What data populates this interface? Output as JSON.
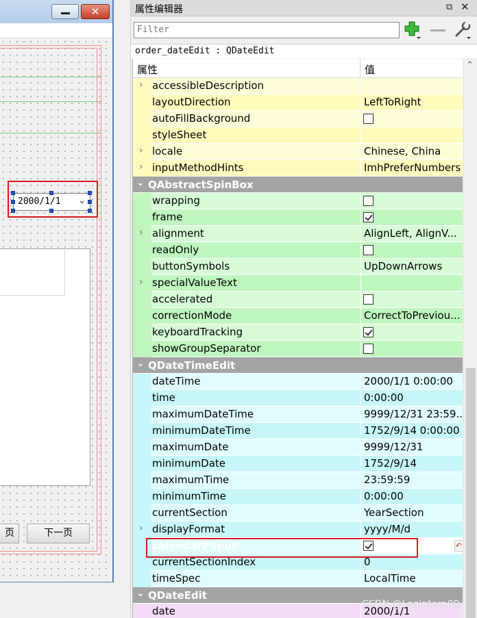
{
  "form": {
    "date_value": "2000/1/1",
    "prev_button": "页",
    "next_button": "下一页"
  },
  "panel": {
    "title": "属性编辑器",
    "filter_placeholder": "Filter",
    "object_label": "order_dateEdit : QDateEdit",
    "col_property": "属性",
    "col_value": "值"
  },
  "icons": {
    "float": "restore-icon",
    "close": "close-icon",
    "add": "plus-icon",
    "remove": "minus-icon",
    "config": "wrench-icon"
  },
  "colors": {
    "qwidget_row": "#fffdd8",
    "qwidget_row_alt": "#fffbbd",
    "spinbox_row": "#d6fbd6",
    "spinbox_row_alt": "#bff5bf",
    "datetime_row": "#e0fcfd",
    "datetime_row_alt": "#c7f6f9",
    "dateedit_row": "#f2dcf6",
    "selection": "#0a74d3",
    "category": "#a4a4a4"
  },
  "rows": [
    {
      "type": "prop",
      "name": "accessibleDescription",
      "value": "",
      "expandable": true,
      "group": "qwidget",
      "alt": false
    },
    {
      "type": "prop",
      "name": "layoutDirection",
      "value": "LeftToRight",
      "group": "qwidget",
      "alt": true
    },
    {
      "type": "prop",
      "name": "autoFillBackground",
      "checkbox": false,
      "group": "qwidget",
      "alt": false
    },
    {
      "type": "prop",
      "name": "styleSheet",
      "value": "",
      "group": "qwidget",
      "alt": true
    },
    {
      "type": "prop",
      "name": "locale",
      "value": "Chinese, China",
      "expandable": true,
      "group": "qwidget",
      "alt": false
    },
    {
      "type": "prop",
      "name": "inputMethodHints",
      "value": "ImhPreferNumbers",
      "expandable": true,
      "group": "qwidget",
      "alt": true
    },
    {
      "type": "cat",
      "name": "QAbstractSpinBox"
    },
    {
      "type": "prop",
      "name": "wrapping",
      "checkbox": false,
      "group": "spinbox",
      "alt": false
    },
    {
      "type": "prop",
      "name": "frame",
      "checkbox": true,
      "group": "spinbox",
      "alt": true
    },
    {
      "type": "prop",
      "name": "alignment",
      "value": "AlignLeft, AlignV...",
      "expandable": true,
      "group": "spinbox",
      "alt": false
    },
    {
      "type": "prop",
      "name": "readOnly",
      "checkbox": false,
      "group": "spinbox",
      "alt": true
    },
    {
      "type": "prop",
      "name": "buttonSymbols",
      "value": "UpDownArrows",
      "group": "spinbox",
      "alt": false
    },
    {
      "type": "prop",
      "name": "specialValueText",
      "value": "",
      "expandable": true,
      "group": "spinbox",
      "alt": true
    },
    {
      "type": "prop",
      "name": "accelerated",
      "checkbox": false,
      "group": "spinbox",
      "alt": false
    },
    {
      "type": "prop",
      "name": "correctionMode",
      "value": "CorrectToPreviou...",
      "group": "spinbox",
      "alt": true
    },
    {
      "type": "prop",
      "name": "keyboardTracking",
      "checkbox": true,
      "group": "spinbox",
      "alt": false
    },
    {
      "type": "prop",
      "name": "showGroupSeparator",
      "checkbox": false,
      "group": "spinbox",
      "alt": true
    },
    {
      "type": "cat",
      "name": "QDateTimeEdit"
    },
    {
      "type": "prop",
      "name": "dateTime",
      "value": "2000/1/1 0:00:00",
      "group": "datetime",
      "alt": false
    },
    {
      "type": "prop",
      "name": "time",
      "value": "0:00:00",
      "group": "datetime",
      "alt": true
    },
    {
      "type": "prop",
      "name": "maximumDateTime",
      "value": "9999/12/31 23:59...",
      "group": "datetime",
      "alt": false
    },
    {
      "type": "prop",
      "name": "minimumDateTime",
      "value": "1752/9/14 0:00:00",
      "group": "datetime",
      "alt": true
    },
    {
      "type": "prop",
      "name": "maximumDate",
      "value": "9999/12/31",
      "group": "datetime",
      "alt": false
    },
    {
      "type": "prop",
      "name": "minimumDate",
      "value": "1752/9/14",
      "group": "datetime",
      "alt": true
    },
    {
      "type": "prop",
      "name": "maximumTime",
      "value": "23:59:59",
      "group": "datetime",
      "alt": false
    },
    {
      "type": "prop",
      "name": "minimumTime",
      "value": "0:00:00",
      "group": "datetime",
      "alt": true
    },
    {
      "type": "prop",
      "name": "currentSection",
      "value": "YearSection",
      "group": "datetime",
      "alt": false
    },
    {
      "type": "prop",
      "name": "displayFormat",
      "value": "yyyy/M/d",
      "expandable": true,
      "group": "datetime",
      "alt": true
    },
    {
      "type": "prop",
      "name": "calendarPopup",
      "checkbox": true,
      "group": "datetime",
      "alt": false,
      "selected": true
    },
    {
      "type": "prop",
      "name": "currentSectionIndex",
      "value": "0",
      "group": "datetime",
      "alt": true
    },
    {
      "type": "prop",
      "name": "timeSpec",
      "value": "LocalTime",
      "group": "datetime",
      "alt": false
    },
    {
      "type": "cat",
      "name": "QDateEdit"
    },
    {
      "type": "prop",
      "name": "date",
      "value": "2000/1/1",
      "group": "dateedit",
      "alt": false
    }
  ],
  "watermark": "CSDN @Logintern09"
}
